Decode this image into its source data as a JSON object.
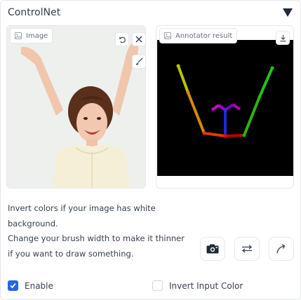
{
  "header": {
    "title": "ControlNet",
    "collapse_icon": "triangle-down-icon"
  },
  "image_panel": {
    "label": "Image",
    "label_icon": "image-icon",
    "tools": [
      "undo-icon",
      "close-icon",
      "brush-icon"
    ]
  },
  "annotator_panel": {
    "label": "Annotator result",
    "label_icon": "image-icon",
    "tools": [
      "download-icon"
    ]
  },
  "help": {
    "line1": "Invert colors if your image has white background.",
    "line2": "Change your brush width to make it thinner if you want to draw something."
  },
  "actions": [
    "camera-icon",
    "swap-icon",
    "send-icon"
  ],
  "checkboxes": {
    "enable": {
      "label": "Enable",
      "checked": true
    },
    "invert": {
      "label": "Invert Input Color",
      "checked": false
    }
  },
  "colors": {
    "accent": "#2563eb",
    "border": "#e5e7eb",
    "pose_background": "#000000"
  }
}
